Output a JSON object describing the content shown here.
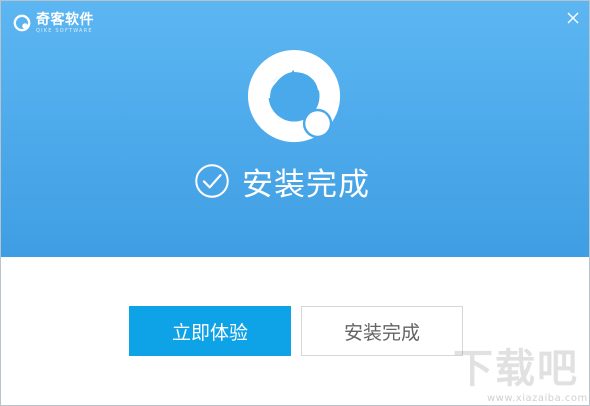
{
  "app": {
    "brand_name": "奇客软件",
    "brand_subtitle": "QIKE SOFTWARE",
    "close_icon": "close-icon"
  },
  "status": {
    "text": "安装完成",
    "icon": "check-circle-icon"
  },
  "logo": {
    "icon": "app-logo-icon"
  },
  "buttons": {
    "primary_label": "立即体验",
    "secondary_label": "安装完成"
  },
  "watermark": {
    "text": "下载吧",
    "sub": "www.xiazaiba.com"
  },
  "colors": {
    "header_top": "#5cb6f2",
    "header_bottom": "#3f9ee3",
    "primary_button": "#0ea3e6",
    "secondary_text": "#646464"
  }
}
